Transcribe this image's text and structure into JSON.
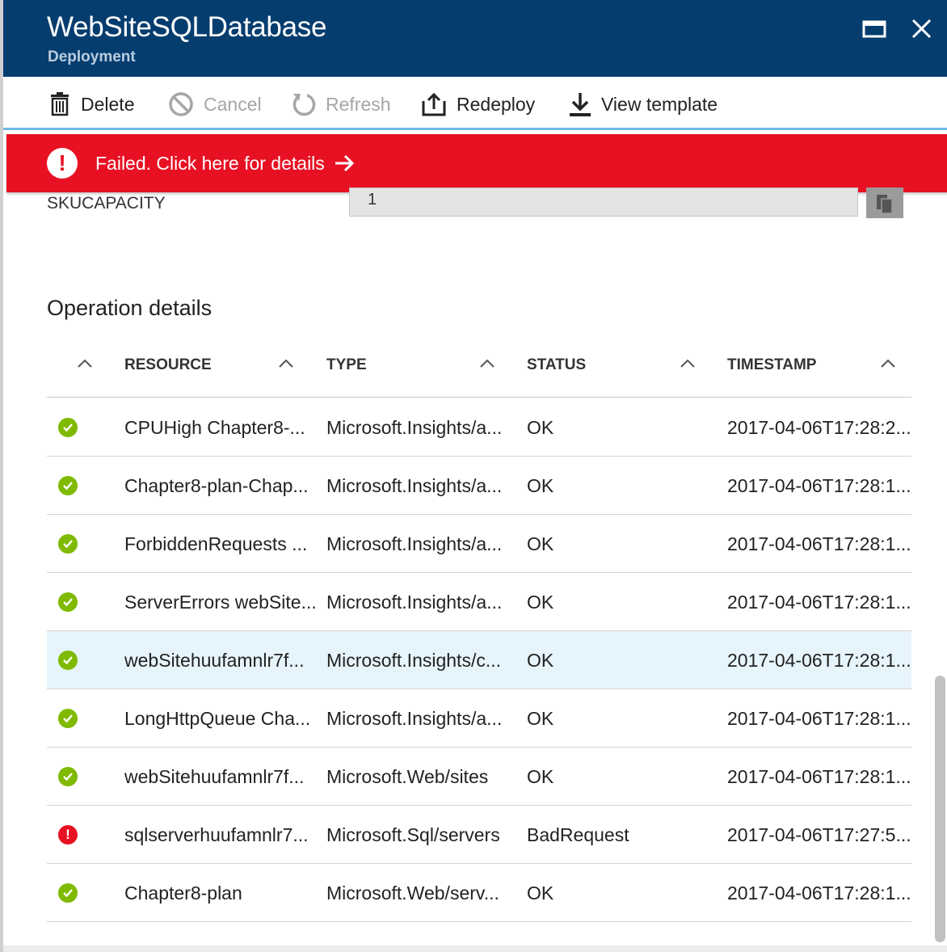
{
  "header": {
    "title": "WebSiteSQLDatabase",
    "subtitle": "Deployment"
  },
  "toolbar": {
    "delete_label": "Delete",
    "cancel_label": "Cancel",
    "refresh_label": "Refresh",
    "redeploy_label": "Redeploy",
    "view_template_label": "View template"
  },
  "banner": {
    "text": "Failed. Click here for details",
    "color": "#e81123"
  },
  "sku": {
    "label": "SKUCAPACITY",
    "value": "1"
  },
  "operations": {
    "title": "Operation details",
    "columns": [
      "RESOURCE",
      "TYPE",
      "STATUS",
      "TIMESTAMP"
    ],
    "rows": [
      {
        "state": "ok",
        "resource": "CPUHigh Chapter8-...",
        "type": "Microsoft.Insights/a...",
        "status": "OK",
        "timestamp": "2017-04-06T17:28:2..."
      },
      {
        "state": "ok",
        "resource": "Chapter8-plan-Chap...",
        "type": "Microsoft.Insights/a...",
        "status": "OK",
        "timestamp": "2017-04-06T17:28:1..."
      },
      {
        "state": "ok",
        "resource": "ForbiddenRequests ...",
        "type": "Microsoft.Insights/a...",
        "status": "OK",
        "timestamp": "2017-04-06T17:28:1..."
      },
      {
        "state": "ok",
        "resource": "ServerErrors webSite...",
        "type": "Microsoft.Insights/a...",
        "status": "OK",
        "timestamp": "2017-04-06T17:28:1..."
      },
      {
        "state": "ok",
        "resource": "webSitehuufamnlr7f...",
        "type": "Microsoft.Insights/c...",
        "status": "OK",
        "timestamp": "2017-04-06T17:28:1..."
      },
      {
        "state": "ok",
        "resource": "LongHttpQueue Cha...",
        "type": "Microsoft.Insights/a...",
        "status": "OK",
        "timestamp": "2017-04-06T17:28:1..."
      },
      {
        "state": "ok",
        "resource": "webSitehuufamnlr7f...",
        "type": "Microsoft.Web/sites",
        "status": "OK",
        "timestamp": "2017-04-06T17:28:1..."
      },
      {
        "state": "error",
        "resource": "sqlserverhuufamnlr7...",
        "type": "Microsoft.Sql/servers",
        "status": "BadRequest",
        "timestamp": "2017-04-06T17:27:5..."
      },
      {
        "state": "ok",
        "resource": "Chapter8-plan",
        "type": "Microsoft.Web/serv...",
        "status": "OK",
        "timestamp": "2017-04-06T17:28:1..."
      }
    ]
  },
  "colors": {
    "header_bg": "#063d6f",
    "ok": "#7fba00",
    "error": "#e81123",
    "selected_row": "#e6f4fb"
  }
}
